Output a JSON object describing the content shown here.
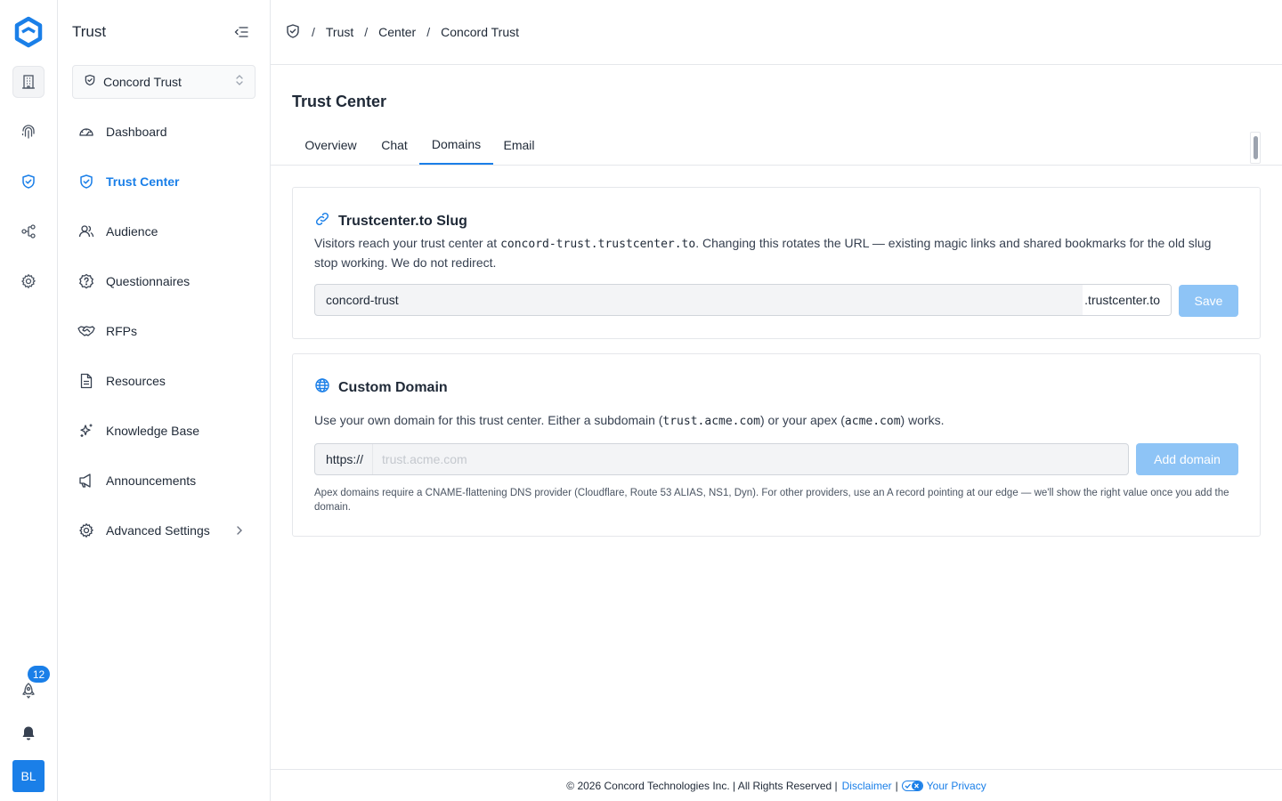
{
  "rail": {
    "notifications_count": "12",
    "avatar_initials": "BL"
  },
  "sidebar": {
    "title": "Trust",
    "org_selector": "Concord Trust",
    "items": [
      {
        "label": "Dashboard",
        "icon": "dashboard-icon"
      },
      {
        "label": "Trust Center",
        "icon": "shield-check-icon"
      },
      {
        "label": "Audience",
        "icon": "users-icon"
      },
      {
        "label": "Questionnaires",
        "icon": "question-badge-icon"
      },
      {
        "label": "RFPs",
        "icon": "handshake-icon"
      },
      {
        "label": "Resources",
        "icon": "document-icon"
      },
      {
        "label": "Knowledge Base",
        "icon": "sparkles-icon"
      },
      {
        "label": "Announcements",
        "icon": "megaphone-icon"
      },
      {
        "label": "Advanced Settings",
        "icon": "gear-icon"
      }
    ],
    "active_item": "Trust Center"
  },
  "breadcrumb": [
    "Trust",
    "Center",
    "Concord Trust"
  ],
  "page": {
    "title": "Trust Center",
    "tabs": [
      "Overview",
      "Chat",
      "Domains",
      "Email"
    ],
    "active_tab": "Domains"
  },
  "slug_card": {
    "title": "Trustcenter.to Slug",
    "desc_before": "Visitors reach your trust center at ",
    "desc_code": "concord-trust.trustcenter.to",
    "desc_after": ". Changing this rotates the URL — existing magic links and shared bookmarks for the old slug stop working. We do not redirect.",
    "input_value": "concord-trust",
    "suffix": ".trustcenter.to",
    "save_label": "Save"
  },
  "domain_card": {
    "title": "Custom Domain",
    "desc_1": "Use your own domain for this trust center. Either a subdomain (",
    "code_1": "trust.acme.com",
    "desc_2": ") or your apex (",
    "code_2": "acme.com",
    "desc_3": ") works.",
    "prefix": "https://",
    "placeholder": "trust.acme.com",
    "add_label": "Add domain",
    "note": "Apex domains require a CNAME-flattening DNS provider (Cloudflare, Route 53 ALIAS, NS1, Dyn). For other providers, use an A record pointing at our edge — we'll show the right value once you add the domain."
  },
  "footer": {
    "copyright": "© 2026 Concord Technologies Inc. | All Rights Reserved |",
    "disclaimer": "Disclaimer",
    "privacy": "Your Privacy"
  },
  "colors": {
    "accent": "#1a7fe8",
    "button_disabled": "#8ec4f6",
    "border": "#e5e7eb"
  }
}
